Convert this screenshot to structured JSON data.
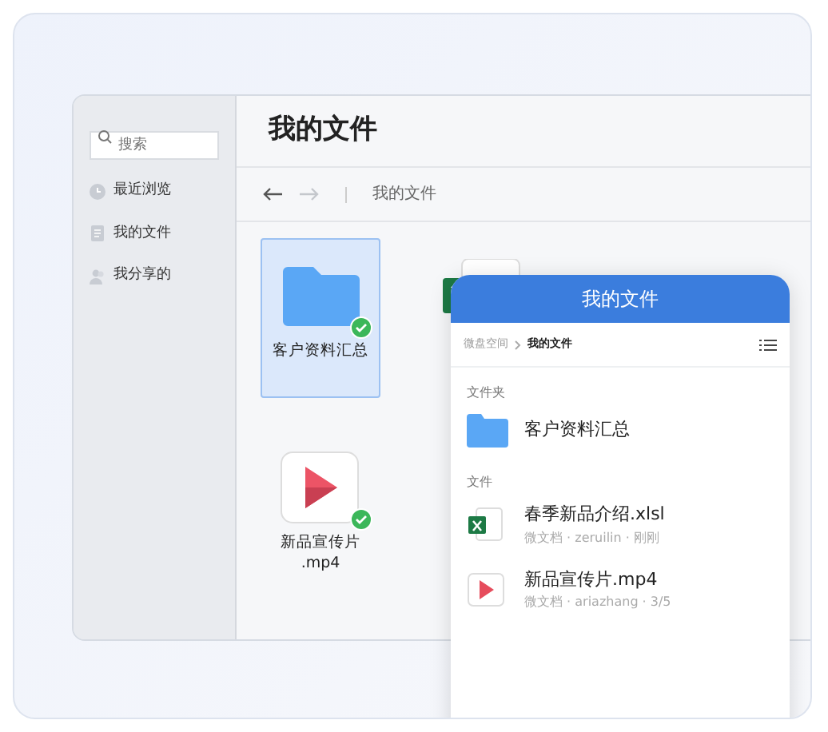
{
  "sidebar": {
    "search": {
      "placeholder": "搜索"
    },
    "items": [
      {
        "kind": "clock",
        "label": "最近浏览"
      },
      {
        "kind": "doc",
        "label": "我的文件"
      },
      {
        "kind": "people",
        "label": "我分享的"
      }
    ]
  },
  "main": {
    "title": "我的文件",
    "nav": {
      "back_disabled": false,
      "forward_disabled": true
    },
    "path": "我的文件",
    "tiles": [
      {
        "kind": "folder",
        "label": "客户资料汇总",
        "selected": true,
        "synced": true
      },
      {
        "kind": "excel",
        "selected": false
      },
      {
        "kind": "video",
        "label": "新品宣传片\n.mp4",
        "selected": false,
        "synced": true
      }
    ]
  },
  "phone": {
    "title": "我的文件",
    "breadcrumb": [
      "微盘空间",
      "我的文件"
    ],
    "sections": [
      {
        "heading": "文件夹",
        "items": [
          {
            "kind": "folder",
            "name": "客户资料汇总"
          }
        ]
      },
      {
        "heading": "文件",
        "items": [
          {
            "kind": "excel",
            "name": "春季新品介绍.xlsl",
            "meta": "微文档 · zeruilin · 刚刚"
          },
          {
            "kind": "video",
            "name": "新品宣传片.mp4",
            "meta": "微文档 · ariazhang · 3/5"
          }
        ]
      }
    ]
  }
}
